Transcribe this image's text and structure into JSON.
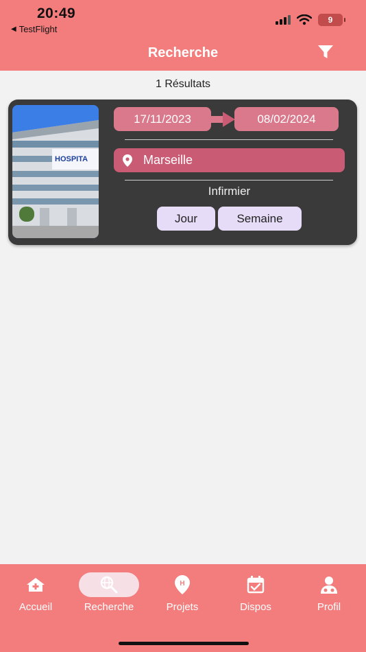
{
  "status_bar": {
    "time": "20:49",
    "back_app": "TestFlight",
    "battery": "9"
  },
  "header": {
    "title": "Recherche",
    "filter_icon": "filter-icon"
  },
  "results": {
    "count_label": "1 Résultats"
  },
  "card": {
    "image_icon": "hospital-building-photo",
    "image_sign": "HOSPITA",
    "start_date": "17/11/2023",
    "end_date": "08/02/2024",
    "location": "Marseille",
    "profession": "Infirmier",
    "chips": [
      "Jour",
      "Semaine"
    ]
  },
  "nav": {
    "items": [
      {
        "label": "Accueil",
        "icon": "home-icon"
      },
      {
        "label": "Recherche",
        "icon": "search-globe-icon",
        "active": true
      },
      {
        "label": "Projets",
        "icon": "hospital-pin-icon"
      },
      {
        "label": "Dispos",
        "icon": "calendar-check-icon"
      },
      {
        "label": "Profil",
        "icon": "doctor-icon"
      }
    ]
  },
  "colors": {
    "brand": "#f37d7d",
    "card_bg": "#3a3a3a",
    "date_pill": "#d9798b",
    "location_pill": "#c95c74",
    "chip_bg": "#e6dcf7"
  }
}
